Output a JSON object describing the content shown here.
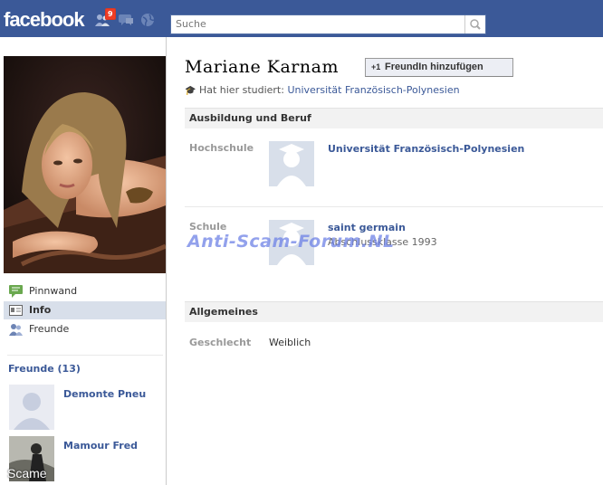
{
  "header": {
    "logo": "facebook",
    "notification_count": "9",
    "search_placeholder": "Suche"
  },
  "profile": {
    "name": "Mariane Karnam",
    "add_friend_button": "FreundIn hinzufügen",
    "studied_prefix": "Hat hier studiert:",
    "studied_school": "Universität Französisch-Polynesien"
  },
  "nav": [
    {
      "label": "Pinnwand"
    },
    {
      "label": "Info"
    },
    {
      "label": "Freunde"
    }
  ],
  "friends": {
    "heading": "Freunde (13)",
    "items": [
      {
        "name": "Demonte Pneu"
      },
      {
        "name": "Mamour Fred"
      }
    ]
  },
  "education": {
    "heading": "Ausbildung und Beruf",
    "college_label": "Hochschule",
    "college_name": "Universität Französisch-Polynesien",
    "school_label": "Schule",
    "school_name": "saint germain",
    "school_sub": "Abschlussklasse 1993"
  },
  "general": {
    "heading": "Allgemeines",
    "gender_label": "Geschlecht",
    "gender_value": "Weiblich"
  },
  "overlays": {
    "watermark": "Anti-Scam-Forum.NL",
    "corner_text": "Scame"
  },
  "colors": {
    "brand_blue": "#3b5998",
    "link_blue": "#3b5998",
    "badge_red": "#f03d25"
  }
}
